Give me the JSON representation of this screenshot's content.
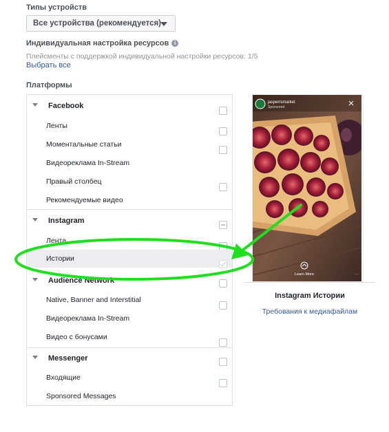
{
  "device_types": {
    "title": "Типы устройств",
    "selected": "Все устройства (рекомендуется)"
  },
  "asset_customization": {
    "title": "Индивидуальная настройка ресурсов",
    "info_glyph": "i",
    "subtitle": "Плейсменты с поддержкой индивидуальной настройки ресурсов: 1/5",
    "select_all": "Выбрать все"
  },
  "platforms": {
    "title": "Платформы",
    "groups": [
      {
        "name": "Facebook",
        "checked": false,
        "items": [
          {
            "label": "Ленты",
            "checked": false
          },
          {
            "label": "Моментальные статьи",
            "checked": false
          },
          {
            "label": "Видеореклама In-Stream",
            "checked": false
          },
          {
            "label": "Правый столбец",
            "checked": false
          },
          {
            "label": "Рекомендуемые видео",
            "checked": false
          }
        ]
      },
      {
        "name": "Instagram",
        "state": "partial",
        "items": [
          {
            "label": "Лента",
            "checked": false
          },
          {
            "label": "Истории",
            "checked": true,
            "highlighted": true
          }
        ]
      },
      {
        "name": "Audience Network",
        "checked": false,
        "items": [
          {
            "label": "Native, Banner and Interstitial",
            "checked": false
          },
          {
            "label": "Видеореклама In-Stream",
            "checked": false
          },
          {
            "label": "Видео с бонусами",
            "checked": false
          }
        ]
      },
      {
        "name": "Messenger",
        "checked": false,
        "items": [
          {
            "label": "Входящие",
            "checked": false
          },
          {
            "label": "Sponsored Messages",
            "checked": false
          }
        ]
      }
    ]
  },
  "preview": {
    "account_name": "jasperrsmarket",
    "sponsored": "Sponsored",
    "cta": "Learn More",
    "title": "Instagram Истории",
    "requirements_link": "Требования к медиафайлам"
  },
  "colors": {
    "link": "#365899",
    "annotation_green": "#1ee01e",
    "highlight_row": "#ecedf0"
  }
}
